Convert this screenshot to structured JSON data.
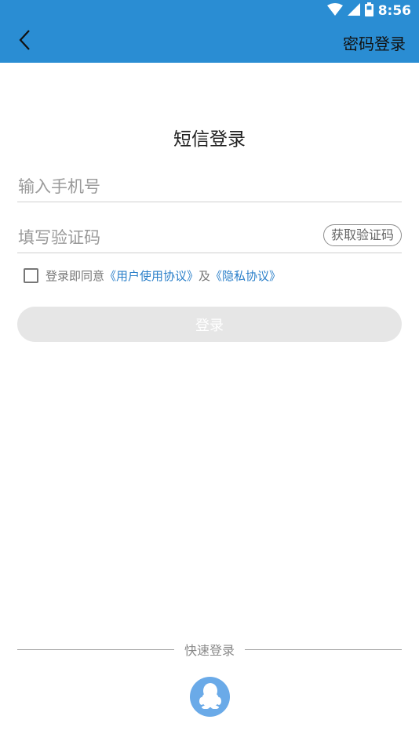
{
  "status_bar": {
    "time": "8:56",
    "icons": [
      "wifi-icon",
      "cell-signal-icon",
      "battery-icon"
    ]
  },
  "header": {
    "back_icon": "back-arrow-icon",
    "password_login_label": "密码登录",
    "background_color": "#2a8dd3"
  },
  "page": {
    "title": "短信登录"
  },
  "form": {
    "phone_placeholder": "输入手机号",
    "code_placeholder": "填写验证码",
    "get_code_label": "获取验证码",
    "agreement": {
      "checked": false,
      "prefix": "登录即同意",
      "user_agreement": "《用户使用协议》",
      "conjunction": "及",
      "privacy_policy": "《隐私协议》",
      "link_color": "#2a7fc9"
    },
    "login_label": "登录"
  },
  "quick_login": {
    "label": "快速登录",
    "qq_icon": "qq-penguin-icon",
    "qq_color": "#6aaae8"
  }
}
